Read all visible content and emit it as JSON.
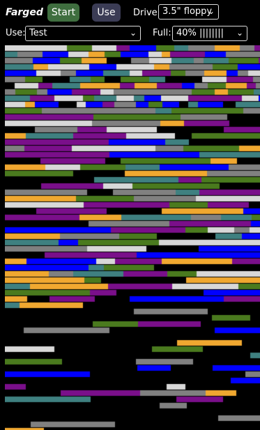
{
  "header": {
    "app_name": "Farged",
    "start_label": "Start",
    "use_label": "Use",
    "drive_label": "Drive:",
    "drive_value": "3.5\" floppy"
  },
  "controls": {
    "use_label": "Use:",
    "use_value": "Test",
    "full_label": "Full:",
    "full_value": "40% ||||||||"
  },
  "icons": {
    "dropdown": "chevron-down-icon"
  },
  "colors": {
    "start_button": "#3f6e3f",
    "use_button": "#3b3c55",
    "fragments": [
      "#0000ff",
      "#f0a830",
      "#4a7a1e",
      "#808080",
      "#d8d8d8",
      "#7a0f8a",
      "#3f8080"
    ]
  }
}
